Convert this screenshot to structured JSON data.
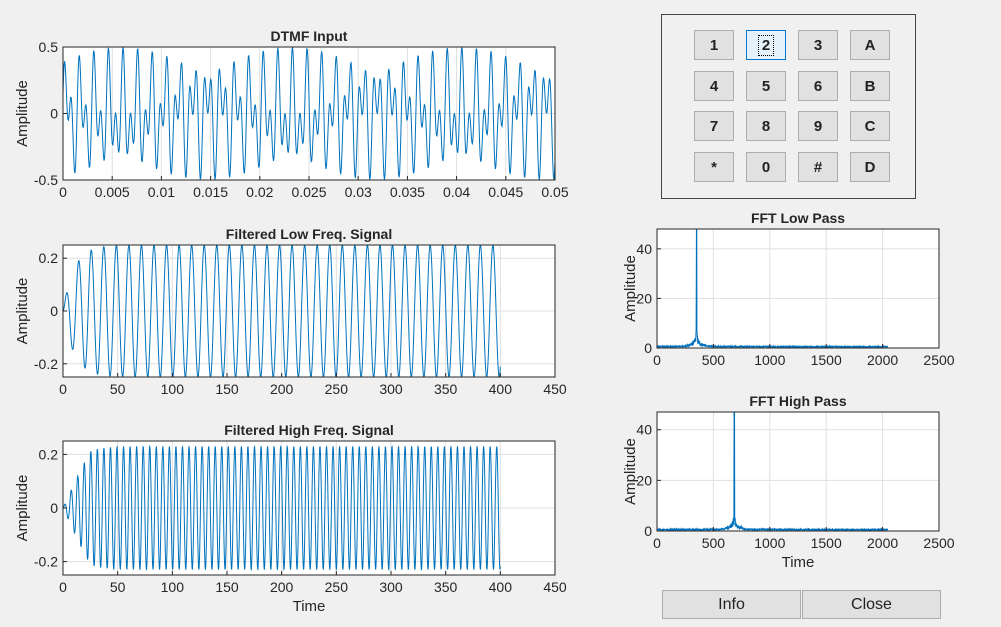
{
  "keypad": {
    "keys": [
      "1",
      "2",
      "3",
      "A",
      "4",
      "5",
      "6",
      "B",
      "7",
      "8",
      "9",
      "C",
      "*",
      "0",
      "#",
      "D"
    ],
    "selected": "2"
  },
  "buttons": {
    "info": "Info",
    "close": "Close"
  },
  "colors": {
    "line": "#0072bd",
    "grid": "#dfdfdf",
    "axes": "#262626",
    "background": "#f0f0f0"
  },
  "chart_data": [
    {
      "id": "dtmf_input",
      "type": "line",
      "title": "DTMF Input",
      "xlabel": "",
      "ylabel": "Amplitude",
      "xlim": [
        0,
        0.05
      ],
      "ylim": [
        -0.5,
        0.5
      ],
      "xticks": [
        0,
        0.005,
        0.01,
        0.015,
        0.02,
        0.025,
        0.03,
        0.035,
        0.04,
        0.045,
        0.05
      ],
      "xticklabels": [
        "0",
        "0.005",
        "0.01",
        "0.015",
        "0.02",
        "0.025",
        "0.03",
        "0.035",
        "0.04",
        "0.045",
        "0.05"
      ],
      "yticks": [
        -0.5,
        0,
        0.5
      ],
      "yticklabels": [
        "-0.5",
        "0",
        "0.5"
      ],
      "grid": true,
      "series": [
        {
          "tones_hz": [
            697,
            1336
          ],
          "amplitude_each": 0.25,
          "x_end": 0.05
        }
      ]
    },
    {
      "id": "low_filtered",
      "type": "line",
      "title": "Filtered Low Freq. Signal",
      "xlabel": "",
      "ylabel": "Amplitude",
      "xlim": [
        0,
        450
      ],
      "ylim": [
        -0.25,
        0.25
      ],
      "xticks": [
        0,
        50,
        100,
        150,
        200,
        250,
        300,
        350,
        400,
        450
      ],
      "xticklabels": [
        "0",
        "50",
        "100",
        "150",
        "200",
        "250",
        "300",
        "350",
        "400",
        "450"
      ],
      "yticks": [
        -0.2,
        0,
        0.2
      ],
      "yticklabels": [
        "-0.2",
        "0",
        "0.2"
      ],
      "grid": true,
      "series": [
        {
          "cycles_per_sample": 0.0871,
          "amplitude": 0.25,
          "x_end": 400
        }
      ]
    },
    {
      "id": "high_filtered",
      "type": "line",
      "title": "Filtered High Freq. Signal",
      "xlabel": "Time",
      "ylabel": "Amplitude",
      "xlim": [
        0,
        450
      ],
      "ylim": [
        -0.25,
        0.25
      ],
      "xticks": [
        0,
        50,
        100,
        150,
        200,
        250,
        300,
        350,
        400,
        450
      ],
      "xticklabels": [
        "0",
        "50",
        "100",
        "150",
        "200",
        "250",
        "300",
        "350",
        "400",
        "450"
      ],
      "yticks": [
        -0.2,
        0,
        0.2
      ],
      "yticklabels": [
        "-0.2",
        "0",
        "0.2"
      ],
      "grid": true,
      "series": [
        {
          "cycles_per_sample": 0.167,
          "amplitude": 0.23,
          "x_end": 400
        }
      ]
    },
    {
      "id": "fft_low",
      "type": "line",
      "title": "FFT Low Pass",
      "xlabel": "",
      "ylabel": "Amplitude",
      "xlim": [
        0,
        2500
      ],
      "ylim": [
        0,
        48
      ],
      "xticks": [
        0,
        500,
        1000,
        1500,
        2000,
        2500
      ],
      "xticklabels": [
        "0",
        "500",
        "1000",
        "1500",
        "2000",
        "2500"
      ],
      "yticks": [
        0,
        20,
        40
      ],
      "yticklabels": [
        "0",
        "20",
        "40"
      ],
      "grid": true,
      "series": [
        {
          "peak_x": 350,
          "peak_y": 48,
          "x_end": 2048
        }
      ]
    },
    {
      "id": "fft_high",
      "type": "line",
      "title": "FFT High Pass",
      "xlabel": "Time",
      "ylabel": "Amplitude",
      "xlim": [
        0,
        2500
      ],
      "ylim": [
        0,
        47
      ],
      "xticks": [
        0,
        500,
        1000,
        1500,
        2000,
        2500
      ],
      "xticklabels": [
        "0",
        "500",
        "1000",
        "1500",
        "2000",
        "2500"
      ],
      "yticks": [
        0,
        20,
        40
      ],
      "yticklabels": [
        "0",
        "20",
        "40"
      ],
      "grid": true,
      "series": [
        {
          "peak_x": 685,
          "peak_y": 47,
          "x_end": 2048
        }
      ]
    }
  ]
}
